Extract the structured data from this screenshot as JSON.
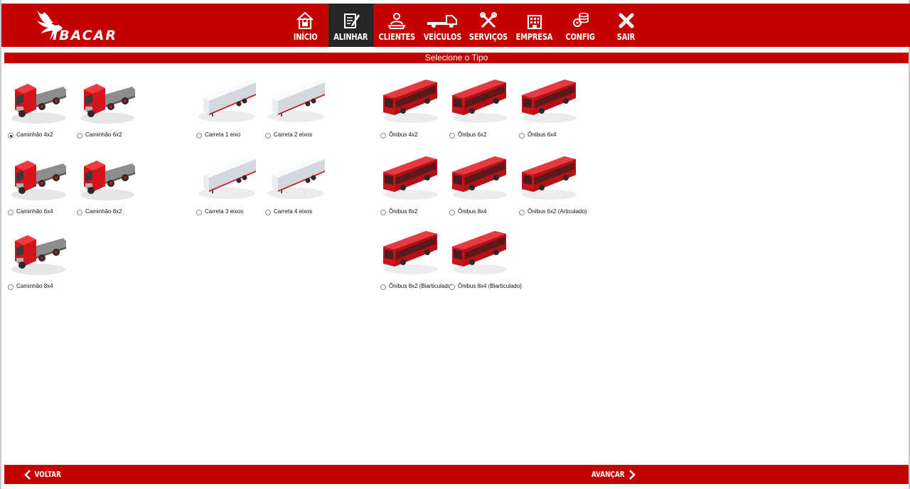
{
  "brand": {
    "name": "IBACAR",
    "color": "#c40000"
  },
  "nav": {
    "items": [
      {
        "id": "inicio",
        "label": "INÍCIO",
        "icon": "home-lock-icon",
        "active": false
      },
      {
        "id": "alinhar",
        "label": "ALINHAR",
        "icon": "edit-document-icon",
        "active": true
      },
      {
        "id": "clientes",
        "label": "CLIENTES",
        "icon": "client-icon",
        "active": false
      },
      {
        "id": "veiculos",
        "label": "VEÍCULOS",
        "icon": "tow-truck-icon",
        "active": false
      },
      {
        "id": "servicos",
        "label": "SERVIÇOS",
        "icon": "tools-icon",
        "active": false
      },
      {
        "id": "empresa",
        "label": "EMPRESA",
        "icon": "building-icon",
        "active": false
      },
      {
        "id": "config",
        "label": "CONFIG",
        "icon": "gear-database-icon",
        "active": false
      },
      {
        "id": "sair",
        "label": "SAIR",
        "icon": "close-icon",
        "active": false
      }
    ]
  },
  "page": {
    "title": "Selecione o Tipo"
  },
  "vehicles": [
    {
      "label": "Caminhão 4x2",
      "kind": "truck",
      "selected": true
    },
    {
      "label": "Caminhão 6x2",
      "kind": "truck",
      "selected": false
    },
    {
      "label": "Carreta 1 eixo",
      "kind": "trailer",
      "selected": false
    },
    {
      "label": "Carreta 2 eixos",
      "kind": "trailer",
      "selected": false
    },
    {
      "label": "Ônibus 4x2",
      "kind": "bus",
      "selected": false
    },
    {
      "label": "Ônibus 6x2",
      "kind": "bus",
      "selected": false
    },
    {
      "label": "Ônibus 6x4",
      "kind": "bus",
      "selected": false
    },
    {
      "label": "Caminhão 6x4",
      "kind": "truck",
      "selected": false
    },
    {
      "label": "Caminhão 8x2",
      "kind": "truck",
      "selected": false
    },
    {
      "label": "Carreta 3 eixos",
      "kind": "trailer",
      "selected": false
    },
    {
      "label": "Carreta 4 eixos",
      "kind": "trailer",
      "selected": false
    },
    {
      "label": "Ônibus 8x2",
      "kind": "bus",
      "selected": false
    },
    {
      "label": "Ônibus 8x4",
      "kind": "bus",
      "selected": false
    },
    {
      "label": "Ônibus 6x2 (Articulado)",
      "kind": "bus",
      "selected": false
    },
    {
      "label": "Caminhão 8x4",
      "kind": "truck",
      "selected": false
    },
    {
      "label": "Ônibus 8x2 (Biarticulado)",
      "kind": "bus",
      "selected": false
    },
    {
      "label": "Ônibus 8x4 (Biarticulado)",
      "kind": "bus",
      "selected": false
    }
  ],
  "footer": {
    "back_label": "VOLTAR",
    "next_label": "AVANÇAR"
  }
}
